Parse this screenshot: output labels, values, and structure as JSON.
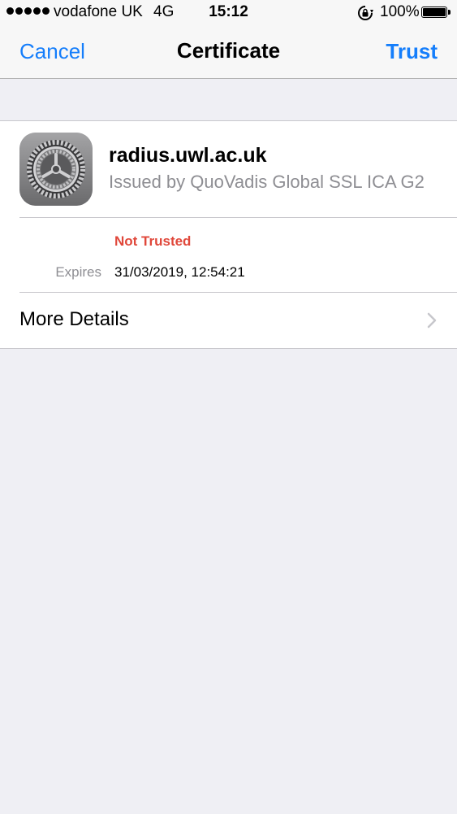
{
  "status_bar": {
    "carrier": "vodafone UK",
    "network": "4G",
    "time": "15:12",
    "battery_percent": "100%"
  },
  "nav": {
    "cancel_label": "Cancel",
    "title": "Certificate",
    "trust_label": "Trust"
  },
  "certificate": {
    "icon": "settings-gear-icon",
    "name": "radius.uwl.ac.uk",
    "issuer": "Issued by QuoVadis Global SSL ICA G2",
    "status": "Not Trusted",
    "expires_label": "Expires",
    "expires_value": "31/03/2019, 12:54:21"
  },
  "more_details": {
    "label": "More Details"
  },
  "colors": {
    "accent": "#157efb",
    "warning": "#e0483b",
    "secondary_text": "#8e8e93",
    "background": "#efeff4"
  }
}
